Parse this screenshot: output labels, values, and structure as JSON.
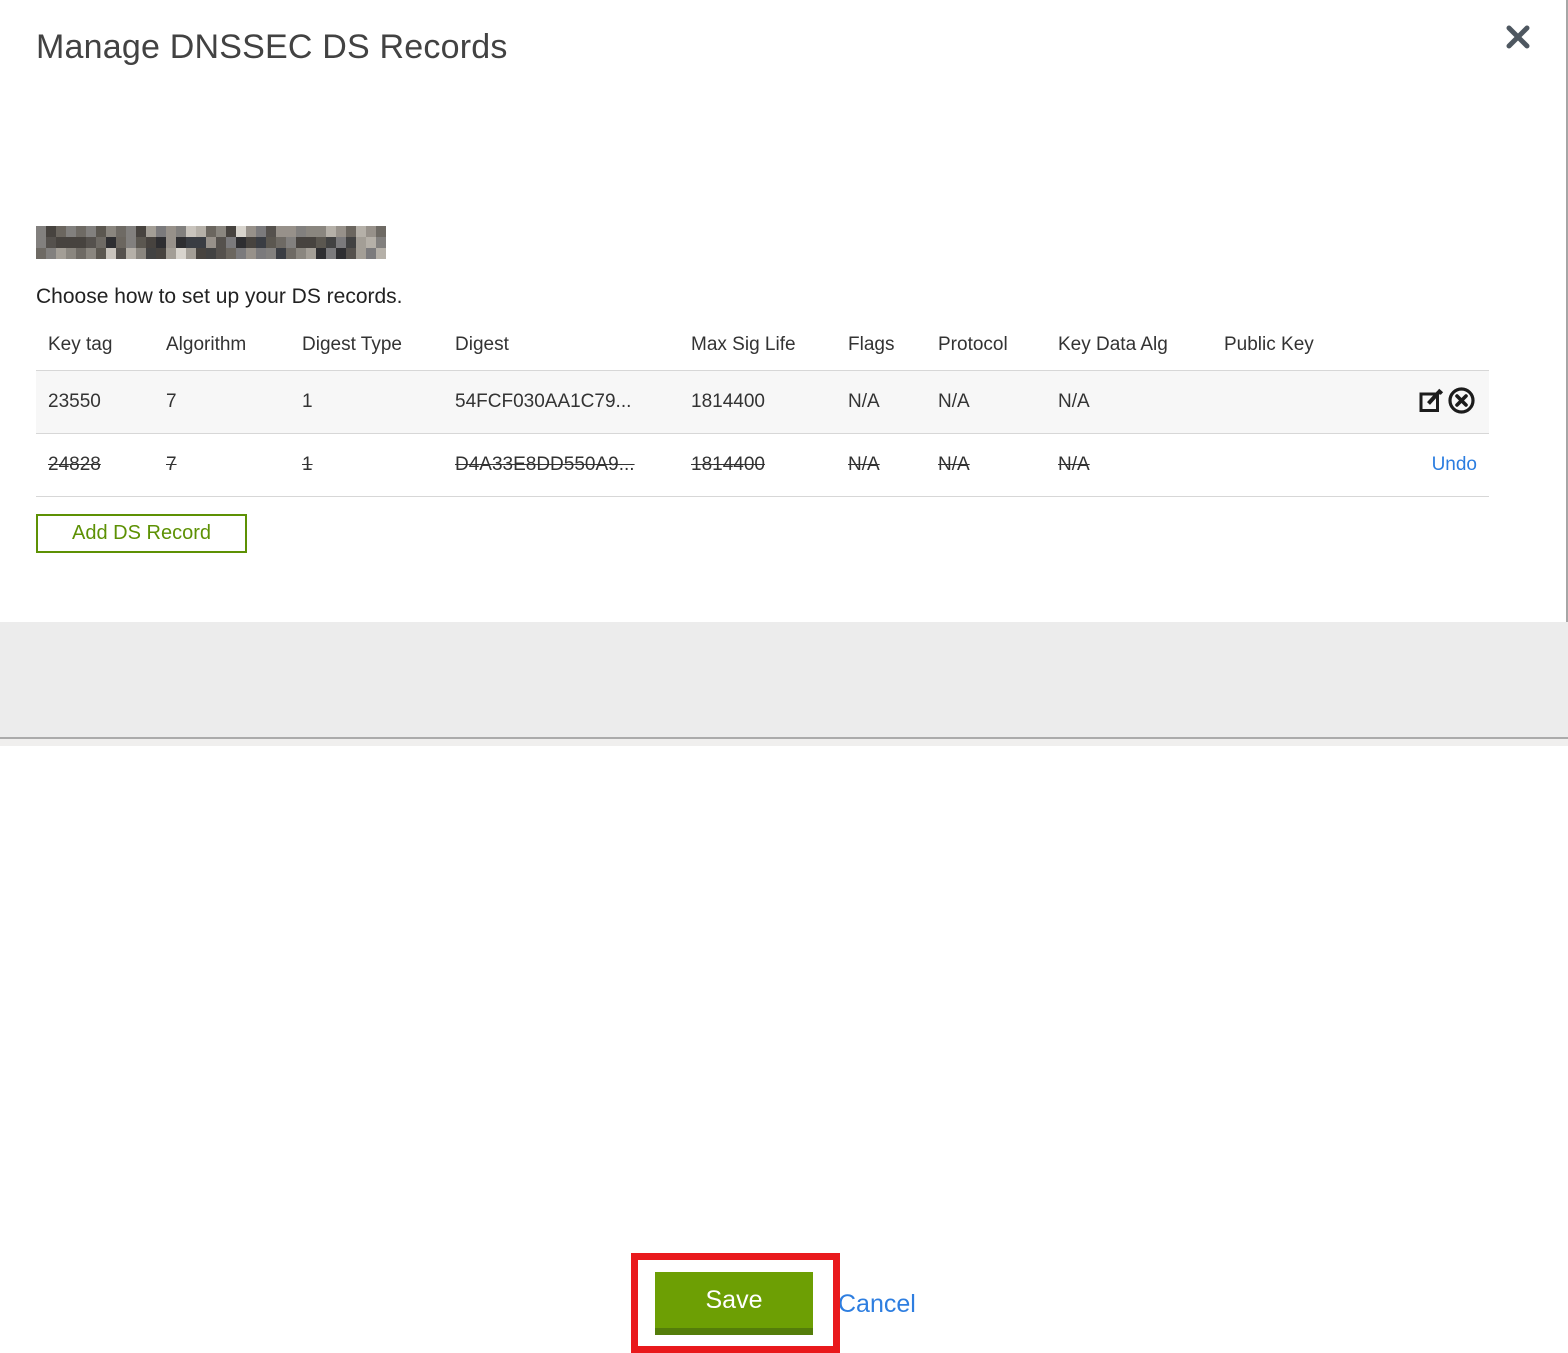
{
  "modal": {
    "title": "Manage DNSSEC DS Records",
    "close_icon": "✕",
    "instruction": "Choose how to set up your DS records.",
    "table": {
      "headers": [
        "Key tag",
        "Algorithm",
        "Digest Type",
        "Digest",
        "Max Sig Life",
        "Flags",
        "Protocol",
        "Key Data Alg",
        "Public Key"
      ],
      "rows": [
        {
          "key_tag": "23550",
          "algorithm": "7",
          "digest_type": "1",
          "digest": "54FCF030AA1C79...",
          "max_sig_life": "1814400",
          "flags": "N/A",
          "protocol": "N/A",
          "key_data_alg": "N/A",
          "public_key": "",
          "deleted": false,
          "actions": [
            "edit-icon",
            "remove-icon"
          ]
        },
        {
          "key_tag": "24828",
          "algorithm": "7",
          "digest_type": "1",
          "digest": "D4A33E8DD550A9...",
          "max_sig_life": "1814400",
          "flags": "N/A",
          "protocol": "N/A",
          "key_data_alg": "N/A",
          "public_key": "",
          "deleted": true,
          "action_label": "Undo"
        }
      ]
    },
    "add_button_label": "Add DS Record",
    "footer": {
      "save_label": "Save",
      "cancel_label": "Cancel"
    }
  },
  "colors": {
    "accent_green": "#5d9104",
    "save_green": "#6d9f04",
    "link_blue": "#2e7ee0",
    "annotation_red": "#e9191c",
    "row_alt_bg": "#f7f7f7",
    "footer_bg": "#ececec"
  }
}
